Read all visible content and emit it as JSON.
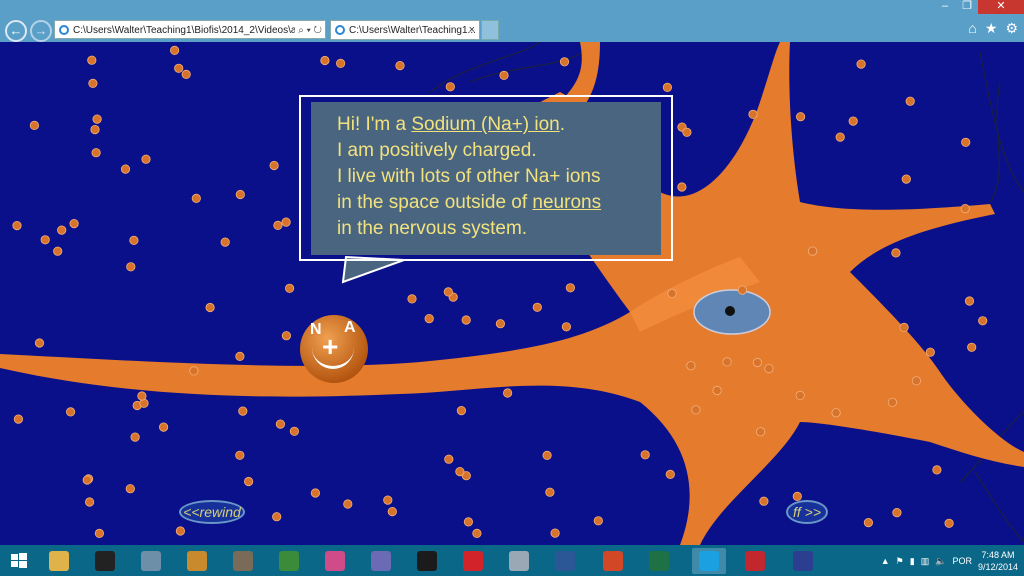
{
  "browser": {
    "address": "C:\\Users\\Walter\\Teaching1\\Biofis\\2014_2\\Videos\\actic",
    "tab_title": "C:\\Users\\Walter\\Teaching1...",
    "tab_close": "×",
    "back_icon": "back-arrow-icon",
    "forward_icon": "forward-arrow-icon"
  },
  "window": {
    "minimize": "–",
    "restore": "❐",
    "close": "✕"
  },
  "toolbar_icons": [
    "home-icon",
    "star-icon",
    "gear-icon"
  ],
  "bubble": {
    "line1_prefix": "Hi! I'm a ",
    "line1_link": "Sodium (Na+) ion",
    "line1_suffix": ".",
    "line2": "I am positively charged.",
    "line3": "I live with lots of other Na+ ions",
    "line4_prefix": "in the space outside of ",
    "line4_link": "neurons",
    "line5": "in the nervous system."
  },
  "ion": {
    "label_left": "N",
    "label_right": "A",
    "charge": "+"
  },
  "controls": {
    "rewind": "<<rewind",
    "ff": "ff >>"
  },
  "taskbar": {
    "apps": [
      "windows-start-icon",
      "file-explorer-icon",
      "command-prompt-icon",
      "calculator-icon",
      "paint-icon",
      "gimp-icon",
      "vim-icon",
      "itunes-icon",
      "media-icon",
      "vmd-icon",
      "acrobat-icon",
      "flash-icon",
      "word-icon",
      "powerpoint-icon",
      "excel-icon",
      "internet-explorer-icon",
      "kaspersky-icon",
      "eclipse-icon"
    ],
    "language": "POR",
    "time": "7:48 AM",
    "date": "9/12/2014"
  },
  "colors": {
    "background": "#0a108a",
    "neuron": "#e57b2c",
    "bubble": "#4a6580",
    "bubble_text": "#f2e27e",
    "chrome": "#5a9fc8",
    "taskbar": "#0b6787"
  }
}
